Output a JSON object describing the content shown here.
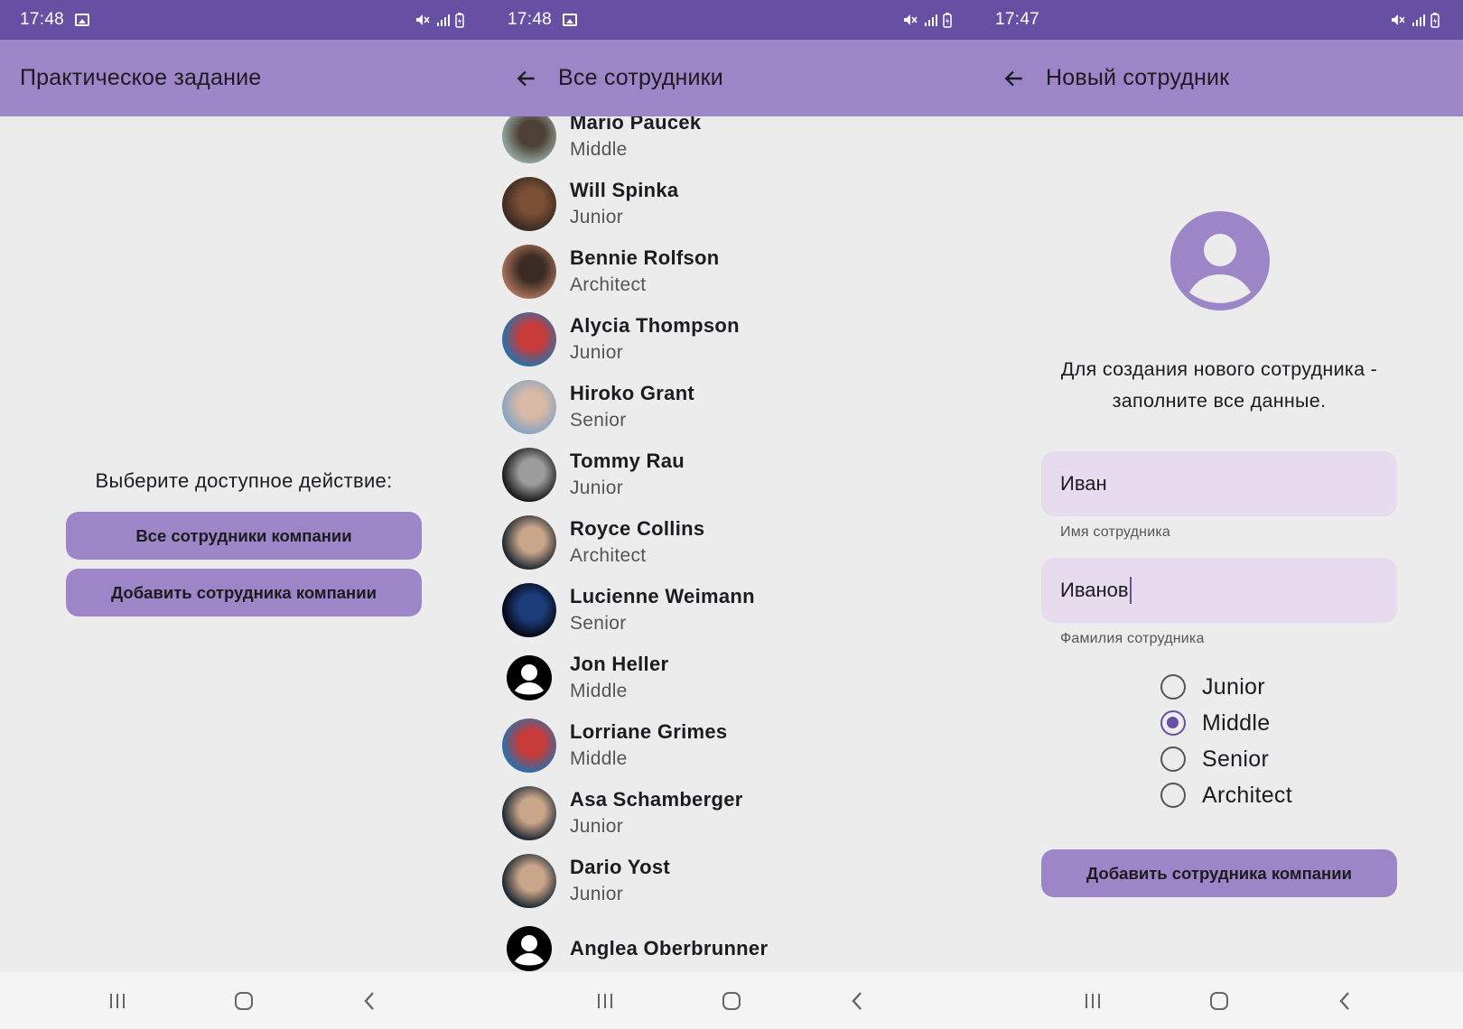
{
  "colors": {
    "status_bar": "#6650a4",
    "app_bar": "#9c86c7",
    "background": "#ececec",
    "field_bg": "#e6dcee",
    "radio_accent": "#6650a4"
  },
  "screen1": {
    "status_time": "17:48",
    "title": "Практическое задание",
    "prompt": "Выберите доступное действие:",
    "btn_all": "Все сотрудники компании",
    "btn_add": "Добавить сотрудника компании"
  },
  "screen2": {
    "status_time": "17:48",
    "title": "Все сотрудники",
    "employees": [
      {
        "name": "Mario Paucek",
        "role": "Middle",
        "avatar": "photo"
      },
      {
        "name": "Will Spinka",
        "role": "Junior",
        "avatar": "photo"
      },
      {
        "name": "Bennie Rolfson",
        "role": "Architect",
        "avatar": "photo"
      },
      {
        "name": "Alycia Thompson",
        "role": "Junior",
        "avatar": "photo"
      },
      {
        "name": "Hiroko Grant",
        "role": "Senior",
        "avatar": "photo"
      },
      {
        "name": "Tommy Rau",
        "role": "Junior",
        "avatar": "photo"
      },
      {
        "name": "Royce Collins",
        "role": "Architect",
        "avatar": "photo"
      },
      {
        "name": "Lucienne Weimann",
        "role": "Senior",
        "avatar": "photo"
      },
      {
        "name": "Jon Heller",
        "role": "Middle",
        "avatar": "default-person-icon"
      },
      {
        "name": "Lorriane Grimes",
        "role": "Middle",
        "avatar": "photo"
      },
      {
        "name": "Asa Schamberger",
        "role": "Junior",
        "avatar": "photo"
      },
      {
        "name": "Dario Yost",
        "role": "Junior",
        "avatar": "photo"
      },
      {
        "name": "Anglea Oberbrunner",
        "role": "",
        "avatar": "default-person-icon"
      }
    ]
  },
  "screen3": {
    "status_time": "17:47",
    "title": "Новый сотрудник",
    "hint": "Для создания нового сотрудника - заполните все данные.",
    "first_name_value": "Иван",
    "first_name_label": "Имя сотрудника",
    "last_name_value": "Иванов",
    "last_name_label": "Фамилия сотрудника",
    "levels": [
      "Junior",
      "Middle",
      "Senior",
      "Architect"
    ],
    "selected_level": "Middle",
    "submit": "Добавить сотрудника компании"
  }
}
